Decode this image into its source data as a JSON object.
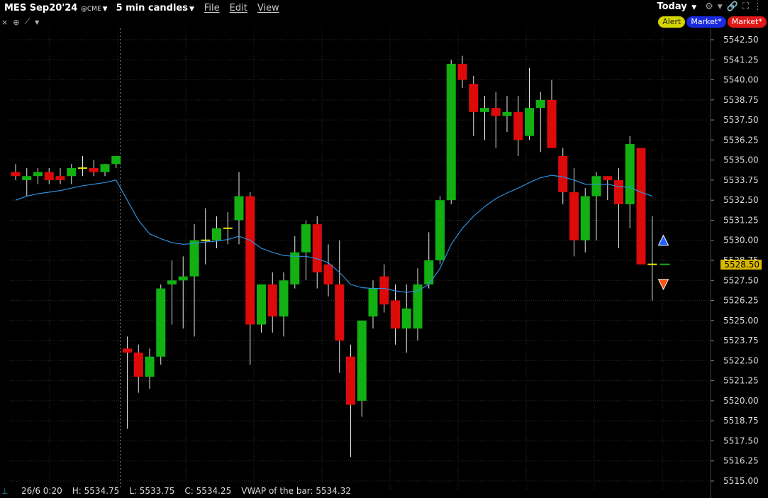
{
  "header": {
    "symbol": "MES Sep20'24",
    "exchange": "@CME",
    "interval": "5 min candles",
    "menu": [
      "File",
      "Edit",
      "View"
    ],
    "range": "Today"
  },
  "buttons": {
    "alert": "Alert",
    "market_buy": "Market*",
    "market_sell": "Market*"
  },
  "colors": {
    "up": "#12b012",
    "down": "#dd0a0a",
    "vwap": "#2f8ed8",
    "flat": "#e8e800",
    "grid": "#2a2a2a",
    "price_tag": "#d8b800"
  },
  "status": {
    "date": "26/6 0:20",
    "high": "H: 5534.75",
    "low": "L: 5533.75",
    "close": "C: 5534.25",
    "vwap": "VWAP of the bar: 5534.32"
  },
  "last_price": "5528.50",
  "chart_data": {
    "type": "candlestick",
    "y_ticks": [
      "5542.50",
      "5541.25",
      "5540.00",
      "5538.75",
      "5537.50",
      "5536.25",
      "5535.00",
      "5533.75",
      "5532.50",
      "5531.25",
      "5530.00",
      "5528.75",
      "5527.50",
      "5526.25",
      "5525.00",
      "5523.75",
      "5522.50",
      "5521.25",
      "5520.00",
      "5518.75",
      "5517.50",
      "5516.25",
      "5515.00"
    ],
    "ylim": [
      5514.75,
      5543.25
    ],
    "session_break_index": 10,
    "candles": [
      {
        "o": 5534.25,
        "h": 5534.75,
        "l": 5533.75,
        "c": 5534.0
      },
      {
        "o": 5533.75,
        "h": 5534.5,
        "l": 5532.75,
        "c": 5534.0
      },
      {
        "o": 5534.0,
        "h": 5534.5,
        "l": 5533.5,
        "c": 5534.25
      },
      {
        "o": 5534.25,
        "h": 5534.5,
        "l": 5533.5,
        "c": 5533.75
      },
      {
        "o": 5534.0,
        "h": 5534.5,
        "l": 5533.5,
        "c": 5533.75
      },
      {
        "o": 5534.0,
        "h": 5534.75,
        "l": 5533.5,
        "c": 5534.5
      },
      {
        "o": 5534.5,
        "h": 5535.25,
        "l": 5534.0,
        "c": 5534.5
      },
      {
        "o": 5534.5,
        "h": 5535.0,
        "l": 5534.0,
        "c": 5534.25
      },
      {
        "o": 5534.25,
        "h": 5534.75,
        "l": 5534.0,
        "c": 5534.75
      },
      {
        "o": 5534.75,
        "h": 5535.25,
        "l": 5534.5,
        "c": 5535.25
      },
      {
        "o": 5523.25,
        "h": 5524.0,
        "l": 5518.25,
        "c": 5523.0
      },
      {
        "o": 5523.0,
        "h": 5523.5,
        "l": 5520.5,
        "c": 5521.5
      },
      {
        "o": 5521.5,
        "h": 5523.25,
        "l": 5520.75,
        "c": 5522.75
      },
      {
        "o": 5522.75,
        "h": 5527.25,
        "l": 5522.25,
        "c": 5527.0
      },
      {
        "o": 5527.25,
        "h": 5528.75,
        "l": 5524.75,
        "c": 5527.5
      },
      {
        "o": 5527.5,
        "h": 5529.0,
        "l": 5524.5,
        "c": 5527.75
      },
      {
        "o": 5527.75,
        "h": 5531.0,
        "l": 5524.0,
        "c": 5530.0
      },
      {
        "o": 5530.0,
        "h": 5532.0,
        "l": 5528.5,
        "c": 5530.0
      },
      {
        "o": 5530.0,
        "h": 5531.5,
        "l": 5529.5,
        "c": 5530.75
      },
      {
        "o": 5530.75,
        "h": 5531.75,
        "l": 5529.75,
        "c": 5530.75
      },
      {
        "o": 5531.25,
        "h": 5534.25,
        "l": 5529.75,
        "c": 5532.75
      },
      {
        "o": 5532.75,
        "h": 5533.0,
        "l": 5522.25,
        "c": 5524.75
      },
      {
        "o": 5524.75,
        "h": 5527.0,
        "l": 5524.25,
        "c": 5527.25
      },
      {
        "o": 5527.25,
        "h": 5528.0,
        "l": 5524.25,
        "c": 5525.25
      },
      {
        "o": 5525.25,
        "h": 5528.0,
        "l": 5524.0,
        "c": 5527.5
      },
      {
        "o": 5527.25,
        "h": 5530.25,
        "l": 5527.0,
        "c": 5529.25
      },
      {
        "o": 5529.25,
        "h": 5531.25,
        "l": 5527.5,
        "c": 5531.0
      },
      {
        "o": 5531.0,
        "h": 5531.5,
        "l": 5527.0,
        "c": 5528.0
      },
      {
        "o": 5528.5,
        "h": 5529.75,
        "l": 5526.5,
        "c": 5527.25
      },
      {
        "o": 5527.25,
        "h": 5530.0,
        "l": 5521.75,
        "c": 5523.75
      },
      {
        "o": 5522.75,
        "h": 5523.5,
        "l": 5516.5,
        "c": 5519.75
      },
      {
        "o": 5520.0,
        "h": 5523.75,
        "l": 5519.0,
        "c": 5525.0
      },
      {
        "o": 5525.25,
        "h": 5527.5,
        "l": 5524.5,
        "c": 5527.0
      },
      {
        "o": 5527.75,
        "h": 5528.5,
        "l": 5525.5,
        "c": 5526.0
      },
      {
        "o": 5526.25,
        "h": 5527.25,
        "l": 5523.5,
        "c": 5524.5
      },
      {
        "o": 5524.5,
        "h": 5527.25,
        "l": 5523.0,
        "c": 5525.75
      },
      {
        "o": 5524.5,
        "h": 5528.25,
        "l": 5523.75,
        "c": 5527.25
      },
      {
        "o": 5527.25,
        "h": 5530.5,
        "l": 5527.0,
        "c": 5528.75
      },
      {
        "o": 5528.75,
        "h": 5532.75,
        "l": 5528.5,
        "c": 5532.5
      },
      {
        "o": 5532.5,
        "h": 5541.25,
        "l": 5532.25,
        "c": 5541.0
      },
      {
        "o": 5541.0,
        "h": 5541.5,
        "l": 5539.5,
        "c": 5540.0
      },
      {
        "o": 5539.75,
        "h": 5540.25,
        "l": 5536.5,
        "c": 5538.0
      },
      {
        "o": 5538.0,
        "h": 5539.0,
        "l": 5536.25,
        "c": 5538.25
      },
      {
        "o": 5538.25,
        "h": 5539.25,
        "l": 5535.75,
        "c": 5537.75
      },
      {
        "o": 5537.75,
        "h": 5539.0,
        "l": 5536.75,
        "c": 5538.0
      },
      {
        "o": 5538.0,
        "h": 5539.0,
        "l": 5535.25,
        "c": 5536.25
      },
      {
        "o": 5536.5,
        "h": 5540.75,
        "l": 5536.25,
        "c": 5538.25
      },
      {
        "o": 5538.25,
        "h": 5539.25,
        "l": 5535.5,
        "c": 5538.75
      },
      {
        "o": 5538.75,
        "h": 5540.0,
        "l": 5535.75,
        "c": 5535.75
      },
      {
        "o": 5535.25,
        "h": 5535.75,
        "l": 5532.25,
        "c": 5533.0
      },
      {
        "o": 5533.0,
        "h": 5534.5,
        "l": 5529.0,
        "c": 5530.0
      },
      {
        "o": 5530.0,
        "h": 5533.25,
        "l": 5529.25,
        "c": 5532.75
      },
      {
        "o": 5532.75,
        "h": 5534.25,
        "l": 5530.0,
        "c": 5534.0
      },
      {
        "o": 5534.0,
        "h": 5534.0,
        "l": 5532.5,
        "c": 5533.75
      },
      {
        "o": 5533.75,
        "h": 5534.5,
        "l": 5529.5,
        "c": 5532.25
      },
      {
        "o": 5532.25,
        "h": 5536.5,
        "l": 5530.75,
        "c": 5536.0
      },
      {
        "o": 5535.75,
        "h": 5535.75,
        "l": 5528.5,
        "c": 5528.5
      },
      {
        "o": 5528.5,
        "h": 5531.5,
        "l": 5526.25,
        "c": 5528.5
      }
    ],
    "vwap": [
      5532.5,
      5532.75,
      5532.9,
      5533.0,
      5533.1,
      5533.25,
      5533.4,
      5533.5,
      5533.6,
      5533.75,
      5532.5,
      5531.25,
      5530.4,
      5530.1,
      5529.85,
      5529.75,
      5529.8,
      5529.9,
      5529.95,
      5530.05,
      5530.25,
      5530.0,
      5529.5,
      5529.25,
      5529.05,
      5529.0,
      5529.0,
      5528.85,
      5528.6,
      5528.0,
      5527.25,
      5527.05,
      5527.0,
      5527.0,
      5526.85,
      5526.75,
      5526.85,
      5527.25,
      5528.25,
      5529.75,
      5530.75,
      5531.5,
      5532.1,
      5532.6,
      5532.95,
      5533.25,
      5533.6,
      5533.9,
      5534.05,
      5533.95,
      5533.75,
      5533.5,
      5533.5,
      5533.5,
      5533.35,
      5533.3,
      5533.0,
      5532.75
    ],
    "markers": [
      {
        "type": "buy-limit",
        "price": 5530.0
      },
      {
        "type": "sell-stop",
        "price": 5527.25
      }
    ]
  }
}
